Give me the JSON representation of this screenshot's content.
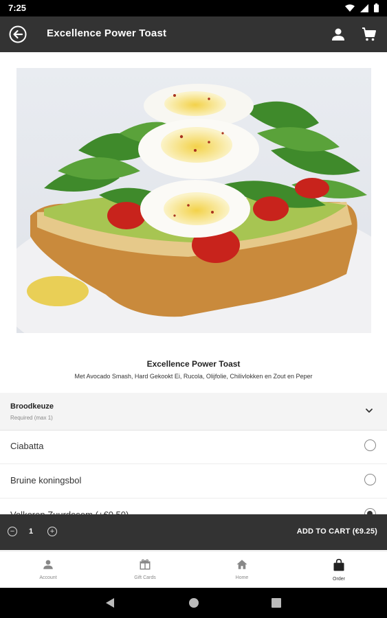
{
  "status_bar": {
    "time": "7:25"
  },
  "app_bar": {
    "title": "Excellence Power Toast"
  },
  "product": {
    "name": "Excellence Power Toast",
    "description": "Met Avocado Smash, Hard Gekookt Ei, Rucola, Olijfolie, Chilivlokken en Zout en Peper"
  },
  "options_section": {
    "heading": "Broodkeuze",
    "requirement": "Required (max 1)",
    "options": [
      {
        "label": "Ciabatta",
        "selected": false
      },
      {
        "label": "Bruine koningsbol",
        "selected": false
      },
      {
        "label": "Volkoren Zuurdesem (+€0.50)",
        "selected": true
      }
    ]
  },
  "cart_bar": {
    "quantity": "1",
    "add_label": "ADD TO CART (€9.25)"
  },
  "bottom_nav": {
    "account": "Account",
    "gift_cards": "Gift Cards",
    "home": "Home",
    "order": "Order"
  },
  "colors": {
    "bar": "#333333",
    "accent": "#333333"
  }
}
